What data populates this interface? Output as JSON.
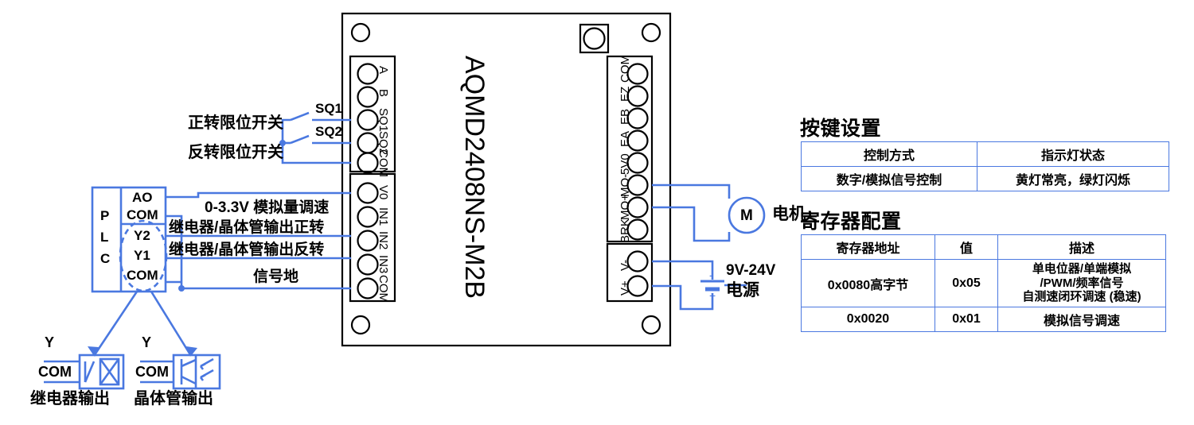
{
  "colors": {
    "wire": "#4a78e0",
    "board_outline": "#000000",
    "table_border": "#4a78e0",
    "text": "#000000"
  },
  "board": {
    "title": "AQMD2408NS-M2B",
    "left_terminal_block_top": [
      "A",
      "B",
      "SQ1",
      "SQ2",
      "COM"
    ],
    "left_terminal_block_bottom": [
      "V0",
      "IN1",
      "IN2",
      "IN3",
      "COM"
    ],
    "right_terminal_block_top": [
      "COM",
      "EZ",
      "EB",
      "EA",
      "5V0",
      "MO-",
      "MO+",
      "BRK"
    ],
    "right_terminal_block_bottom": [
      "V-",
      "V+"
    ]
  },
  "switches": {
    "sq1_label": "SQ1",
    "sq2_label": "SQ2",
    "forward_limit_label": "正转限位开关",
    "reverse_limit_label": "反转限位开关"
  },
  "plc": {
    "name_chars": [
      "P",
      "L",
      "C"
    ],
    "terminals": [
      "AO",
      "COM"
    ],
    "outputs": [
      "Y2",
      "Y1",
      "COM"
    ]
  },
  "wire_labels": {
    "analog": "0-3.3V 模拟量调速",
    "forward": "继电器/晶体管输出正转",
    "reverse": "继电器/晶体管输出反转",
    "signal_ground": "信号地"
  },
  "output_symbols": [
    {
      "y_label": "Y",
      "com_label": "COM",
      "caption": "继电器输出",
      "kind": "relay"
    },
    {
      "y_label": "Y",
      "com_label": "COM",
      "caption": "晶体管输出",
      "kind": "transistor"
    }
  ],
  "motor": {
    "symbol": "M",
    "label": "电机"
  },
  "power": {
    "voltage": "9V-24V",
    "label": "电源",
    "plus": "+",
    "minus": "-"
  },
  "key_settings": {
    "title": "按键设置",
    "headers": [
      "控制方式",
      "指示灯状态"
    ],
    "rows": [
      [
        "数字/模拟信号控制",
        "黄灯常亮，绿灯闪烁"
      ]
    ]
  },
  "register_config": {
    "title": "寄存器配置",
    "headers": [
      "寄存器地址",
      "值",
      "描述"
    ],
    "rows": [
      [
        "0x0080高字节",
        "0x05",
        "单电位器/单端模拟\n/PWM/频率信号\n自测速闭环调速 (稳速)"
      ],
      [
        "0x0020",
        "0x01",
        "模拟信号调速"
      ]
    ]
  }
}
